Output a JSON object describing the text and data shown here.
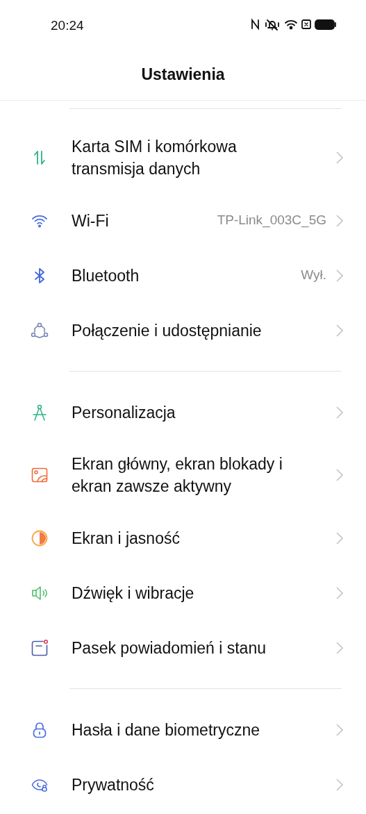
{
  "status_bar": {
    "time": "20:24"
  },
  "title": "Ustawienia",
  "sections": [
    {
      "items": [
        {
          "kind": "mobile-data",
          "label": "Karta SIM i komórkowa transmisja danych"
        },
        {
          "kind": "wifi",
          "label": "Wi-Fi",
          "value": "TP-Link_003C_5G"
        },
        {
          "kind": "bluetooth",
          "label": "Bluetooth",
          "value": "Wył."
        },
        {
          "kind": "connection",
          "label": "Połączenie i udostępnianie"
        }
      ]
    },
    {
      "items": [
        {
          "kind": "compass",
          "label": "Personalizacja"
        },
        {
          "kind": "wallpaper",
          "label": "Ekran główny, ekran blokady i ekran zawsze aktywny"
        },
        {
          "kind": "brightness",
          "label": "Ekran i jasność"
        },
        {
          "kind": "sound",
          "label": "Dźwięk i wibracje"
        },
        {
          "kind": "notification",
          "label": "Pasek powiadomień i stanu"
        }
      ]
    },
    {
      "items": [
        {
          "kind": "lock",
          "label": "Hasła i dane biometryczne"
        },
        {
          "kind": "privacy",
          "label": "Prywatność"
        }
      ]
    }
  ]
}
